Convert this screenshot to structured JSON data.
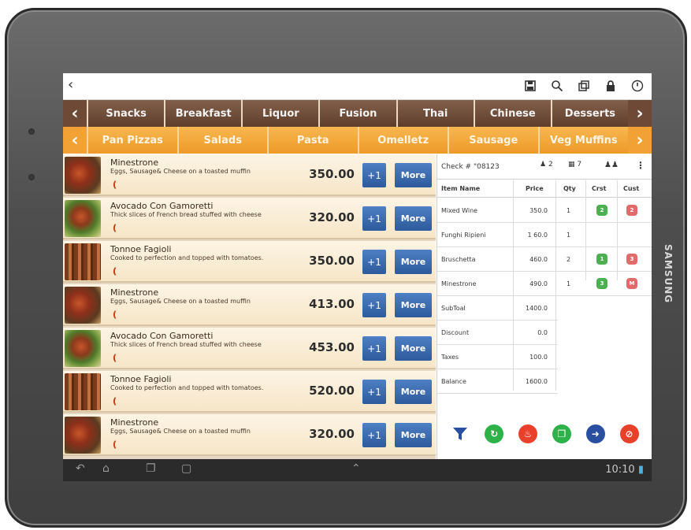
{
  "device": {
    "brand": "SAMSUNG"
  },
  "topbar": {
    "back_icon": "chevron-left-icon",
    "icons": [
      "save-icon",
      "search-icon",
      "windows-icon",
      "lock-icon",
      "power-icon"
    ]
  },
  "categories": {
    "prev_icon": "chevron-left-icon",
    "next_icon": "chevron-right-icon",
    "items": [
      "Snacks",
      "Breakfast",
      "Liquor",
      "Fusion",
      "Thai",
      "Chinese",
      "Desserts"
    ]
  },
  "subcategories": {
    "prev_icon": "chevron-left-icon",
    "next_icon": "chevron-right-icon",
    "items": [
      "Pan Pizzas",
      "Salads",
      "Pasta",
      "Omelletz",
      "Sausage",
      "Veg Muffins"
    ]
  },
  "menu_items": [
    {
      "name": "Minestrone",
      "desc": "Eggs, Sausage& Cheese on a toasted muffin",
      "price": "350.00",
      "plus_label": "+1",
      "more_label": "More"
    },
    {
      "name": "Avocado Con Gamoretti",
      "desc": "Thick slices of French bread stuffed with cheese",
      "price": "320.00",
      "plus_label": "+1",
      "more_label": "More"
    },
    {
      "name": "Tonnoe Fagioli",
      "desc": "Cooked to perfection and topped with tomatoes.",
      "price": "350.00",
      "plus_label": "+1",
      "more_label": "More"
    },
    {
      "name": "Minestrone",
      "desc": "Eggs, Sausage& Cheese on a toasted muffin",
      "price": "413.00",
      "plus_label": "+1",
      "more_label": "More"
    },
    {
      "name": "Avocado Con Gamoretti",
      "desc": "Thick slices of French bread stuffed with cheese",
      "price": "453.00",
      "plus_label": "+1",
      "more_label": "More"
    },
    {
      "name": "Tonnoe Fagioli",
      "desc": "Cooked to perfection and topped with tomatoes.",
      "price": "520.00",
      "plus_label": "+1",
      "more_label": "More"
    },
    {
      "name": "Minestrone",
      "desc": "Eggs, Sausage& Cheese on a toasted muffin",
      "price": "320.00",
      "plus_label": "+1",
      "more_label": "More"
    }
  ],
  "order": {
    "check_label": "Check # \"08123",
    "guests": "2",
    "table": "7",
    "columns": {
      "item": "Item Name",
      "price": "Price",
      "qty": "Qty",
      "cat": "Crst",
      "cust": "Cust"
    },
    "lines": [
      {
        "name": "Mixed Wine",
        "price": "350.0",
        "qty": "1",
        "cat": "2",
        "cust": "2"
      },
      {
        "name": "Funghi Ripieni",
        "price": "1 60.0",
        "qty": "1",
        "cat": "",
        "cust": ""
      },
      {
        "name": "Bruschetta",
        "price": "460.0",
        "qty": "2",
        "cat": "1",
        "cust": "3"
      },
      {
        "name": "Minestrone",
        "price": "490.0",
        "qty": "1",
        "cat": "3",
        "cust": "M"
      }
    ],
    "totals": [
      {
        "label": "SubToal",
        "value": "1400.0"
      },
      {
        "label": "Discount",
        "value": "0.0"
      },
      {
        "label": "Taxes",
        "value": "100.0"
      },
      {
        "label": "Balance",
        "value": "1600.0"
      }
    ],
    "actions": [
      {
        "icon": "filter-icon",
        "color": "#2a4fa0"
      },
      {
        "icon": "refresh-icon",
        "color": "#2db24a"
      },
      {
        "icon": "fire-icon",
        "color": "#e8402a"
      },
      {
        "icon": "copy-icon",
        "color": "#2db24a"
      },
      {
        "icon": "arrow-right-icon",
        "color": "#2a4fa0"
      },
      {
        "icon": "cancel-icon",
        "color": "#e8402a"
      }
    ]
  },
  "statusbar": {
    "time": "10:10"
  },
  "colors": {
    "category_bar": "#6e4a36",
    "subcategory_bar": "#f2a235",
    "button_blue": "#3a6ab0"
  }
}
